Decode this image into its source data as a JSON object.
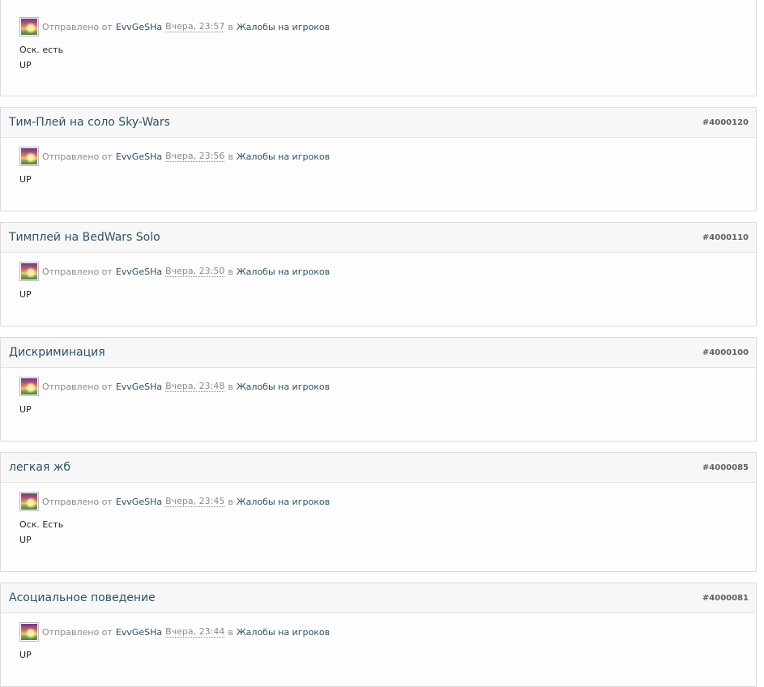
{
  "posts": [
    {
      "author": "EvvGeSHa",
      "sent_label": "Отправлено от",
      "time": "Вчера, 23:57",
      "in_label": "в",
      "forum": "Жалобы на игроков",
      "lines": [
        "Оск. есть",
        "UP"
      ]
    },
    {
      "title": "Тим-Плей на соло Sky-Wars",
      "id": "#4000120",
      "author": "EvvGeSHa",
      "sent_label": "Отправлено от",
      "time": "Вчера, 23:56",
      "in_label": "в",
      "forum": "Жалобы на игроков",
      "lines": [
        "UP"
      ]
    },
    {
      "title": "Тимплей на BedWars Solo",
      "id": "#4000110",
      "author": "EvvGeSHa",
      "sent_label": "Отправлено от",
      "time": "Вчера, 23:50",
      "in_label": "в",
      "forum": "Жалобы на игроков",
      "lines": [
        "UP"
      ]
    },
    {
      "title": "Дискриминация",
      "id": "#4000100",
      "author": "EvvGeSHa",
      "sent_label": "Отправлено от",
      "time": "Вчера, 23:48",
      "in_label": "в",
      "forum": "Жалобы на игроков",
      "lines": [
        "UP"
      ]
    },
    {
      "title": "легкая жб",
      "id": "#4000085",
      "author": "EvvGeSHa",
      "sent_label": "Отправлено от",
      "time": "Вчера, 23:45",
      "in_label": "в",
      "forum": "Жалобы на игроков",
      "lines": [
        "Оск. Есть",
        "UP"
      ]
    },
    {
      "title": "Асоциальное поведение",
      "id": "#4000081",
      "author": "EvvGeSHa",
      "sent_label": "Отправлено от",
      "time": "Вчера, 23:44",
      "in_label": "в",
      "forum": "Жалобы на игроков",
      "lines": [
        "UP"
      ]
    }
  ]
}
